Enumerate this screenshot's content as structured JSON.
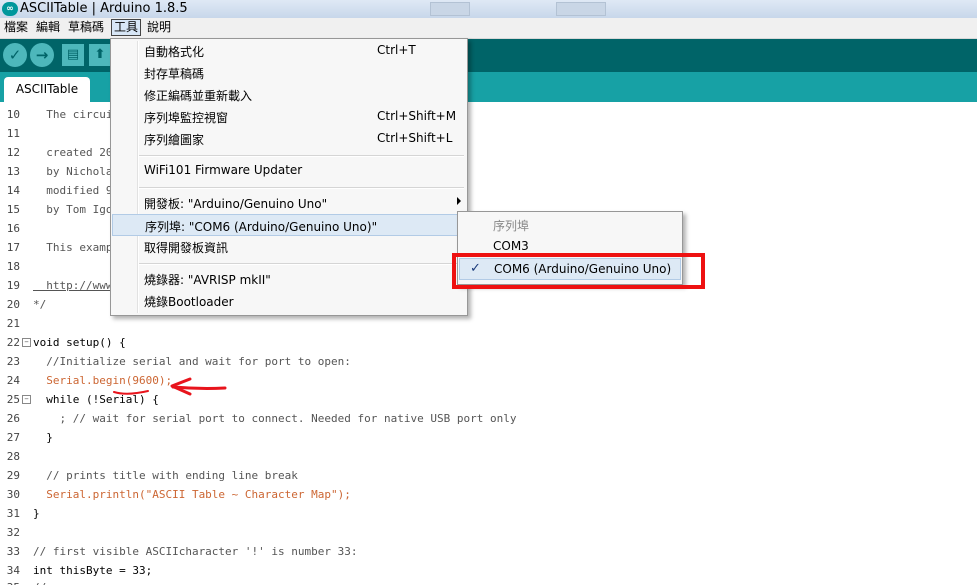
{
  "window": {
    "title": "ASCIITable | Arduino 1.8.5",
    "app_icon_glyph": "∞"
  },
  "menubar": [
    "檔案",
    "編輯",
    "草稿碼",
    "工具",
    "說明"
  ],
  "toolbar": {
    "verify_glyph": "✓",
    "upload_glyph": "→",
    "new_glyph": "▤",
    "open_glyph": "⬆"
  },
  "tab": {
    "label": "ASCIITable"
  },
  "tools_menu": {
    "items": [
      {
        "label": "自動格式化",
        "shortcut": "Ctrl+T"
      },
      {
        "label": "封存草稿碼",
        "shortcut": ""
      },
      {
        "label": "修正編碼並重新載入",
        "shortcut": ""
      },
      {
        "label": "序列埠監控視窗",
        "shortcut": "Ctrl+Shift+M"
      },
      {
        "label": "序列繪圖家",
        "shortcut": "Ctrl+Shift+L"
      },
      {
        "label": "WiFi101 Firmware Updater",
        "shortcut": ""
      },
      {
        "label": "開發板: \"Arduino/Genuino Uno\"",
        "shortcut": ""
      },
      {
        "label": "序列埠: \"COM6 (Arduino/Genuino Uno)\"",
        "shortcut": ""
      },
      {
        "label": "取得開發板資訊",
        "shortcut": ""
      },
      {
        "label": "燒錄器: \"AVRISP mkII\"",
        "shortcut": ""
      },
      {
        "label": "燒錄Bootloader",
        "shortcut": ""
      }
    ]
  },
  "port_submenu": {
    "header": "序列埠",
    "items": [
      {
        "label": "COM3",
        "checked": false
      },
      {
        "label": "COM6 (Arduino/Genuino Uno)",
        "checked": true
      }
    ],
    "check_glyph": "✓"
  },
  "editor": {
    "lines": [
      {
        "n": "10",
        "text": "  The circuit:"
      },
      {
        "n": "11",
        "text": ""
      },
      {
        "n": "12",
        "text": "  created 2006"
      },
      {
        "n": "13",
        "text": "  by Nicholas Zambetti"
      },
      {
        "n": "14",
        "text": "  modified 9 Apr 2012"
      },
      {
        "n": "15",
        "text": "  by Tom Igoe"
      },
      {
        "n": "16",
        "text": ""
      },
      {
        "n": "17",
        "text": "  This example code is in the public domain."
      },
      {
        "n": "18",
        "text": ""
      },
      {
        "n": "19",
        "text": "  http://www.arduino.cc/en/Tutorial/ASCIITable"
      },
      {
        "n": "20",
        "text": "*/"
      },
      {
        "n": "21",
        "text": ""
      },
      {
        "n": "22",
        "text": "void setup() {"
      },
      {
        "n": "23",
        "text": "  //Initialize serial and wait for port to open:"
      },
      {
        "n": "24",
        "text": "  Serial.begin(9600);"
      },
      {
        "n": "25",
        "text": "  while (!Serial) {"
      },
      {
        "n": "26",
        "text": "    ; // wait for serial port to connect. Needed for native USB port only"
      },
      {
        "n": "27",
        "text": "  }"
      },
      {
        "n": "28",
        "text": ""
      },
      {
        "n": "29",
        "text": "  // prints title with ending line break"
      },
      {
        "n": "30",
        "text": "  Serial.println(\"ASCII Table ~ Character Map\");"
      },
      {
        "n": "31",
        "text": "}"
      },
      {
        "n": "32",
        "text": ""
      },
      {
        "n": "33",
        "text": "// first visible ASCIIcharacter '!' is number 33:"
      },
      {
        "n": "34",
        "text": "int thisByte = 33;"
      },
      {
        "n": "35",
        "text": "//"
      }
    ],
    "fold_glyph": "−"
  },
  "colors": {
    "toolbar_bg": "#006468",
    "tabbar_bg": "#17a1a5",
    "highlight_box": "#ee1111",
    "annotation_arrow": "#e8141c"
  }
}
